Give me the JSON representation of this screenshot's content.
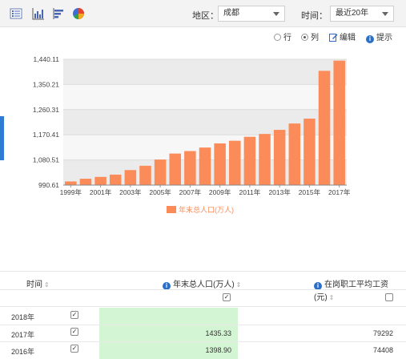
{
  "toolbar": {
    "icons": [
      "list-view-icon",
      "bar-chart-icon",
      "horizontal-bar-icon",
      "pie-chart-icon"
    ],
    "region_label": "地区：",
    "region_value": "成都",
    "time_label": "时间：",
    "time_value": "最近20年"
  },
  "viewbar": {
    "row_label": "行",
    "col_label": "列",
    "selected": "列",
    "edit_label": "编辑",
    "hint_label": "提示"
  },
  "chart_data": {
    "type": "bar",
    "categories": [
      "1999年",
      "2000年",
      "2001年",
      "2002年",
      "2003年",
      "2004年",
      "2005年",
      "2006年",
      "2007年",
      "2008年",
      "2009年",
      "2010年",
      "2011年",
      "2012年",
      "2013年",
      "2014年",
      "2015年",
      "2016年",
      "2017年"
    ],
    "x_tick_labels": [
      "1999年",
      "2001年",
      "2003年",
      "2005年",
      "2007年",
      "2009年",
      "2011年",
      "2013年",
      "2015年",
      "2017年"
    ],
    "series": [
      {
        "name": "年末总人口(万人)",
        "color": "#fb8c5a",
        "values": [
          1003.6,
          1013.4,
          1019.9,
          1028.0,
          1044.3,
          1059.7,
          1082.0,
          1103.4,
          1112.2,
          1124.9,
          1139.6,
          1149.1,
          1163.3,
          1173.4,
          1188.0,
          1210.7,
          1228.1,
          1398.9,
          1435.33
        ]
      }
    ],
    "y_ticks": [
      "990.61",
      "1,080.51",
      "1,170.41",
      "1,260.31",
      "1,350.21",
      "1,440.11"
    ],
    "ylim": [
      990.61,
      1440.11
    ],
    "grid": true,
    "legend_position": "bottom"
  },
  "table": {
    "headers": {
      "time": "时间",
      "population": "年末总人口(万人)",
      "wage": "在岗职工平均工资(元)"
    },
    "sort_glyph": "⇕",
    "rows": [
      {
        "year": "2018年",
        "population": "",
        "wage": ""
      },
      {
        "year": "2017年",
        "population": "1435.33",
        "wage": "79292"
      },
      {
        "year": "2016年",
        "population": "1398.90",
        "wage": "74408"
      }
    ]
  }
}
